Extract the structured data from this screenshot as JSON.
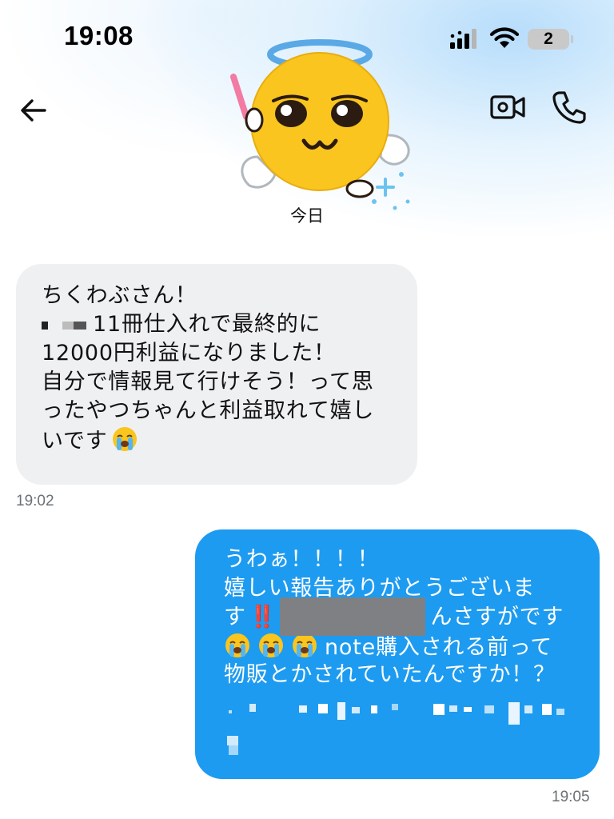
{
  "status": {
    "time": "19:08",
    "battery": "2"
  },
  "nav": {
    "back_icon": "arrow-left-icon",
    "video_icon": "video-call-icon",
    "phone_icon": "phone-icon",
    "avatar": "angel-face-emoji-avatar",
    "date_separator": "今日"
  },
  "messages": [
    {
      "direction": "incoming",
      "lines": [
        "ちくわぶさん！",
        "11冊仕入れで最終的に",
        "12000円利益になりました！",
        "自分で情報見て行けそう！って思",
        "ったやつちゃんと利益取れて嬉し",
        "いです"
      ],
      "emoji": "loudly-crying-face",
      "time": "19:02"
    },
    {
      "direction": "outgoing",
      "lines": [
        "うわぁ！！！！",
        "嬉しい報告ありがとうございま",
        "す",
        "んさすがです",
        "note購入される前って",
        "物販とかされていたんですか！？"
      ],
      "double_exclamation": "‼️",
      "emoji": "loudly-crying-face",
      "time": "19:05"
    }
  ],
  "colors": {
    "incoming_bubble": "#eff0f2",
    "outgoing_bubble": "#1d9bf0",
    "timestamp": "#6b7177",
    "redaction": "#7f8083"
  }
}
